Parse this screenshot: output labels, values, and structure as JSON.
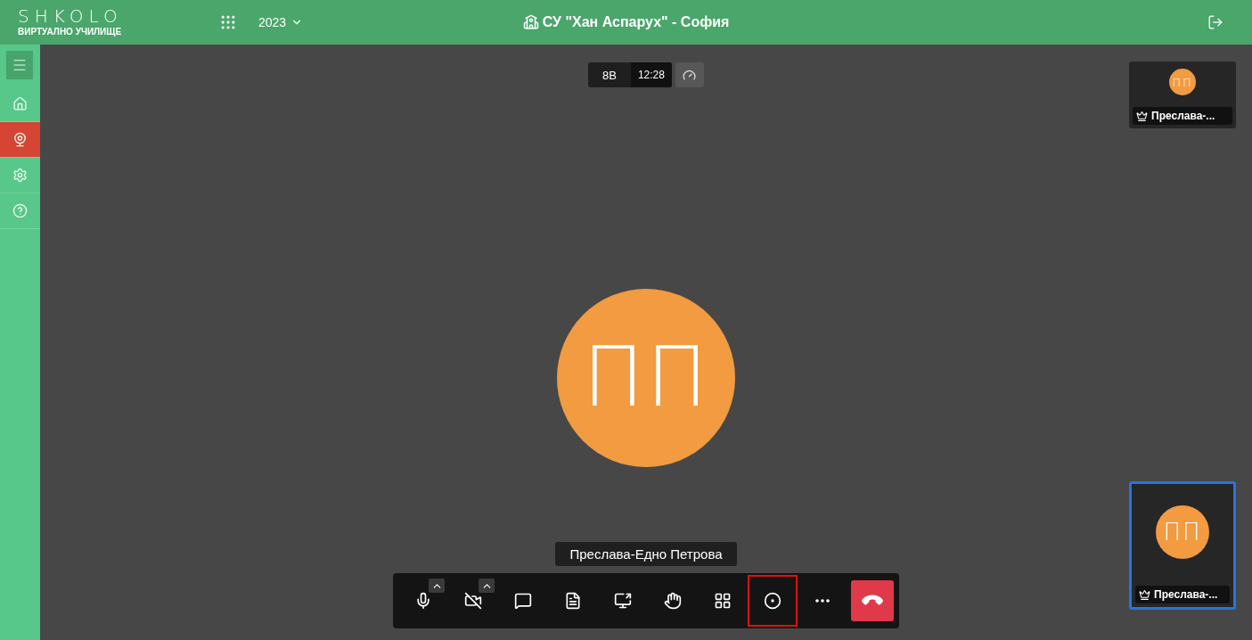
{
  "header": {
    "logo": "SHKOLO",
    "tagline": "ВИРТУАЛНО УЧИЛИЩЕ",
    "year": "2023",
    "school": "СУ \"Хан Аспарух\" - София"
  },
  "sidebar": {
    "items": [
      {
        "kind": "menu",
        "selected": false
      },
      {
        "kind": "home",
        "selected": false
      },
      {
        "kind": "webcam",
        "selected": true
      },
      {
        "kind": "settings",
        "selected": false
      },
      {
        "kind": "help",
        "selected": false
      }
    ]
  },
  "meeting": {
    "class": "8В",
    "time": "12:28",
    "speaker": {
      "initials": "ПП",
      "color": "#f29b41"
    },
    "speaker_name": "Преслава-Едно Петрова",
    "toolbar": [
      {
        "kind": "mic",
        "has_menu": true,
        "highlighted": false
      },
      {
        "kind": "camera_off",
        "has_menu": true,
        "highlighted": false
      },
      {
        "kind": "chat",
        "has_menu": false,
        "highlighted": false
      },
      {
        "kind": "document",
        "has_menu": false,
        "highlighted": false
      },
      {
        "kind": "share",
        "has_menu": false,
        "highlighted": false
      },
      {
        "kind": "hand",
        "has_menu": false,
        "highlighted": false
      },
      {
        "kind": "grid",
        "has_menu": false,
        "highlighted": false
      },
      {
        "kind": "record",
        "has_menu": false,
        "highlighted": true
      },
      {
        "kind": "more",
        "has_menu": false,
        "highlighted": false
      },
      {
        "kind": "hangup",
        "has_menu": false,
        "highlighted": false
      }
    ]
  },
  "thumbnails": [
    {
      "initials": "ПП",
      "name": "Преслава-...",
      "selected": false
    },
    {
      "initials": "ПП",
      "name": "Преслава-...",
      "selected": true
    }
  ]
}
